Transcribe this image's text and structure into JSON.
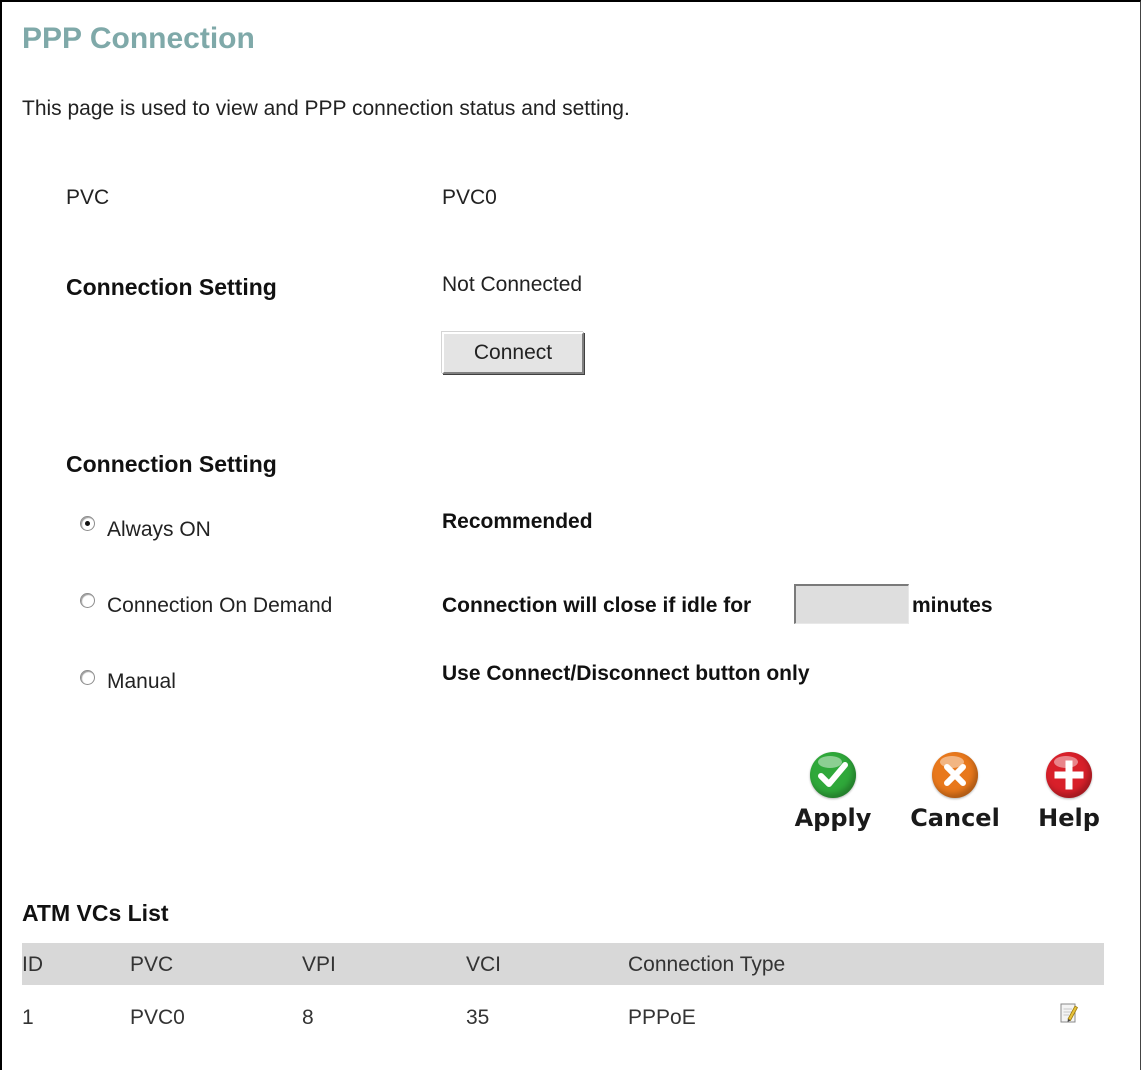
{
  "page": {
    "title": "PPP Connection",
    "description": "This page is used to view and PPP connection status and setting."
  },
  "pvc": {
    "label": "PVC",
    "value": "PVC0"
  },
  "status": {
    "heading": "Connection Setting",
    "value": "Not Connected",
    "connect_button": "Connect"
  },
  "mode": {
    "heading": "Connection Setting",
    "options": [
      {
        "label": "Always ON",
        "note": "Recommended",
        "selected": true
      },
      {
        "label": "Connection On Demand",
        "note": "Connection will close if idle for",
        "suffix": "minutes",
        "selected": false
      },
      {
        "label": "Manual",
        "note": "Use Connect/Disconnect button only",
        "selected": false
      }
    ],
    "idle_minutes": ""
  },
  "actions": {
    "apply": "Apply",
    "cancel": "Cancel",
    "help": "Help"
  },
  "atm_list": {
    "title": "ATM VCs List",
    "columns": [
      "ID",
      "PVC",
      "VPI",
      "VCI",
      "Connection Type"
    ],
    "rows": [
      [
        "1",
        "PVC0",
        "8",
        "35",
        "PPPoE"
      ]
    ]
  },
  "icons": {
    "apply": "check-icon",
    "cancel": "x-icon",
    "help": "plus-icon",
    "edit": "edit-note-icon"
  },
  "colors": {
    "title": "#7fa9a9",
    "apply_green": "#2fa83a",
    "cancel_orange": "#e8781c",
    "help_red": "#d8202a",
    "table_header": "#d8d8d8"
  }
}
